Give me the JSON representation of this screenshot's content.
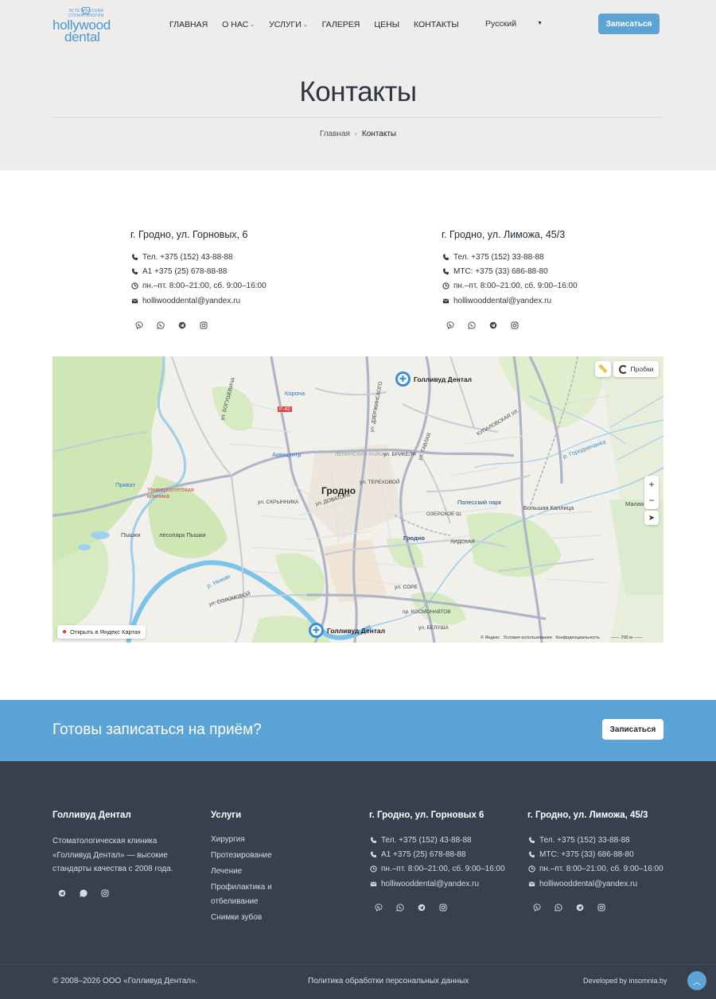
{
  "logo": {
    "tagline": "ЭСТЕТИЧЕСКАЯ СТОМАТОЛОГИЯ",
    "word1": "hollywood",
    "word2": "dental"
  },
  "nav": {
    "items": [
      {
        "label": "ГЛАВНАЯ",
        "caret": false
      },
      {
        "label": "О НАС",
        "caret": true
      },
      {
        "label": "УСЛУГИ",
        "caret": true
      },
      {
        "label": "ГАЛЕРЕЯ",
        "caret": false
      },
      {
        "label": "ЦЕНЫ",
        "caret": false
      },
      {
        "label": "КОНТАКТЫ",
        "caret": false
      }
    ],
    "language": "Русский",
    "signup_label": "Записаться"
  },
  "hero": {
    "title": "Контакты",
    "breadcrumb_home": "Главная",
    "breadcrumb_sep": "›",
    "breadcrumb_current": "Контакты"
  },
  "contacts": [
    {
      "address": "г. Гродно, ул. Горновых, 6",
      "phone1": "Тел. +375 (152) 43-88-88",
      "phone2": "А1 +375 (25) 678-88-88",
      "hours": "пн.–пт. 8:00–21:00, сб. 9:00–16:00",
      "email": "holliwooddental@yandex.ru"
    },
    {
      "address": "г. Гродно, ул. Лиможа, 45/3",
      "phone1": "Тел. +375 (152) 33-88-88",
      "phone2": "МТС: +375 (33) 686-88-80",
      "hours": "пн.–пт. 8:00–21:00, сб. 9:00–16:00",
      "email": "holliwooddental@yandex.ru"
    }
  ],
  "map": {
    "pin1": "Голливуд Дентал",
    "pin2": "Голливуд Дентал",
    "traffic": "Пробки",
    "open_label": "Открыть в Яндекс Картах",
    "copyright": "© Яндекс",
    "terms": "Условия использования",
    "privacy": "Конфиденциальность",
    "scale": "700 м",
    "zoom_in": "+",
    "zoom_out": "−",
    "labels": {
      "city": "Гродно",
      "district": "ЛЕНИНСКИЙ РАЙОН",
      "korona": "Корона",
      "aquacenter": "Аквацентр",
      "privat": "Приват",
      "univ": "Университетская клиника",
      "pyshki": "Пышки",
      "park_pyshki": "лесопарк Пышки",
      "polessky": "Полесский парк",
      "grodno_st": "Гродно",
      "kaplitsa": "Большая Каплица",
      "malaya": "Малая К",
      "r42": "Р-42",
      "gorodnichanka": "р. Городничанка",
      "neman": "р. Неман",
      "kosmonavtov": "пр. КОСМОНАВТОВ",
      "brikelya": "ул. БРИКЕЛЯ",
      "dovatora": "ул. ДОВАТОРА",
      "ozerskoe": "ОЗЕРСКОЕ Ш.",
      "skrynnikova": "ул. СКРЫННИКА",
      "lidskaya": "ЛИДСКАЯ",
      "dzerzhinskogo": "ул. ДЗЕРЖИНСКОГО",
      "kupalovskaya": "КУПАЛОВСКАЯ УЛ.",
      "solomovoy": "ул. СОЛОМОВОЙ",
      "sore": "ул. СОРЕ",
      "tavlaya": "ул. ТАВЛАЯ",
      "bogushevicha": "ул. БОГУШЕВИЧА",
      "terekhovoy": "ул. ТЕРЕХОВОЙ",
      "belusha": "ул. БЕЛУША"
    }
  },
  "cta": {
    "title": "Готовы записаться на приём?",
    "button": "Записаться"
  },
  "footer": {
    "brand_title": "Голливуд Дентал",
    "brand_desc": "Стоматологическая клиника «Голливуд Дентал» — высокие стандарты качества с 2008 года.",
    "services_title": "Услуги",
    "services": [
      "Хирургия",
      "Протезирование",
      "Лечение",
      "Профилактика и отбеливание",
      "Снимки зубов"
    ],
    "col3_title": "г. Гродно, ул. Горновых 6",
    "col4_title": "г. Гродно, ул. Лиможа, 45/3",
    "copyright": "© 2008–2026 ООО «Голливуд Дентал».",
    "policy": "Политика обработки персональных данных",
    "developed": "Developed by insomnia.by"
  },
  "colors": {
    "accent": "#5da4d6",
    "footer_bg": "#36414d",
    "hero_bg": "#eeedeb"
  }
}
